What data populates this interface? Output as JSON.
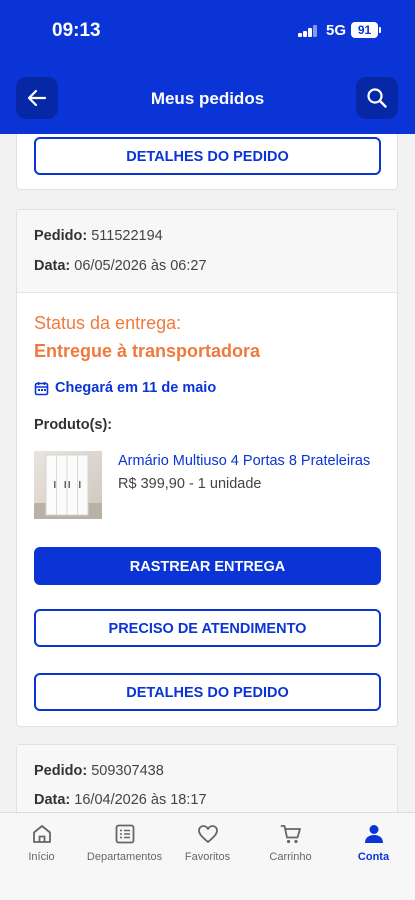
{
  "status_bar": {
    "time": "09:13",
    "network": "5G",
    "battery": "91"
  },
  "header": {
    "title": "Meus pedidos"
  },
  "orders": [
    {
      "details_button": "DETALHES DO PEDIDO"
    },
    {
      "order_label": "Pedido:",
      "order_number": "511522194",
      "date_label": "Data:",
      "date": "06/05/2026 às 06:27",
      "status_label": "Status da entrega:",
      "status_value": "Entregue à transportadora",
      "arrival": "Chegará em 11 de maio",
      "products_label": "Produto(s):",
      "product_name": "Armário Multiuso 4 Portas 8 Prateleiras",
      "product_price": "R$ 399,90 - 1 unidade",
      "track_button": "RASTREAR ENTREGA",
      "support_button": "PRECISO DE ATENDIMENTO",
      "details_button": "DETALHES DO PEDIDO"
    },
    {
      "order_label": "Pedido:",
      "order_number": "509307438",
      "date_label": "Data:",
      "date": "16/04/2026 às 18:17"
    }
  ],
  "tabbar": [
    {
      "label": "Início",
      "icon": "home-icon"
    },
    {
      "label": "Departamentos",
      "icon": "departments-icon"
    },
    {
      "label": "Favoritos",
      "icon": "heart-icon"
    },
    {
      "label": "Carrinho",
      "icon": "cart-icon"
    },
    {
      "label": "Conta",
      "icon": "user-icon",
      "active": true
    }
  ],
  "colors": {
    "primary": "#0a34d6",
    "status": "#ef7a3e"
  }
}
